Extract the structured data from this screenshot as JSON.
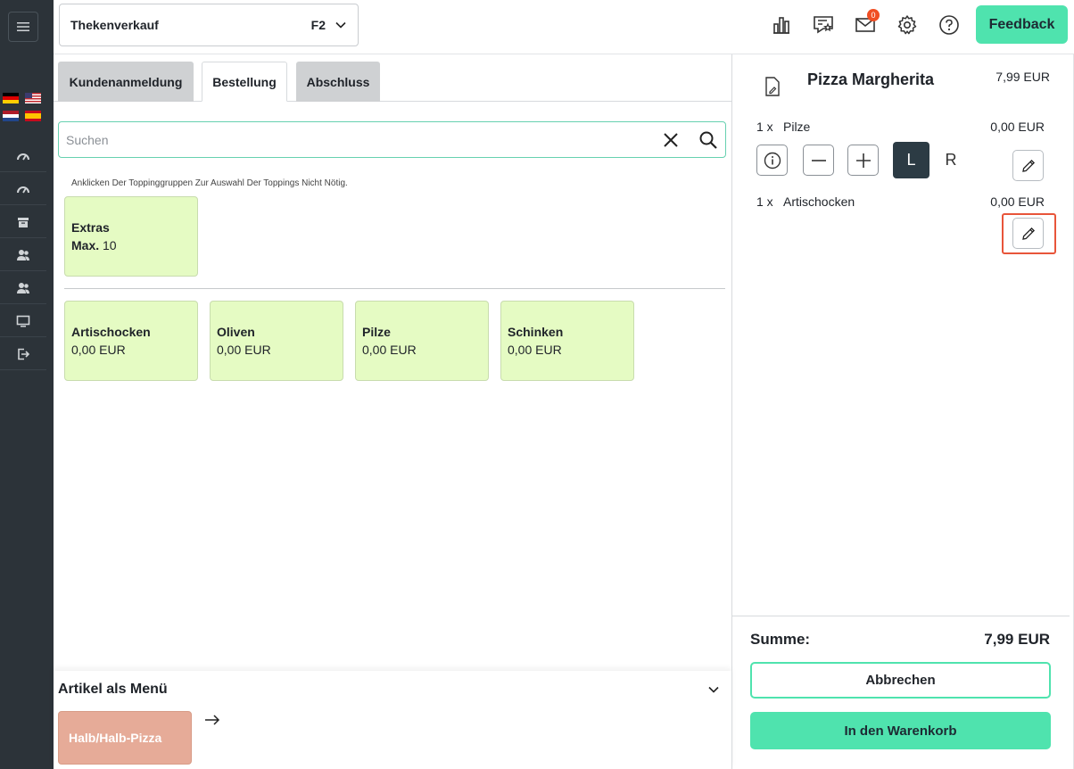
{
  "header": {
    "store_name": "Thekenverkauf",
    "store_key": "F2",
    "mail_count": "0",
    "feedback_label": "Feedback"
  },
  "tabs": [
    {
      "label": "Kundenanmeldung"
    },
    {
      "label": "Bestellung"
    },
    {
      "label": "Abschluss"
    }
  ],
  "search": {
    "placeholder": "Suchen",
    "value": ""
  },
  "hint": "Anklicken Der Toppinggruppen Zur Auswahl Der Toppings Nicht Nötig.",
  "group": {
    "title": "Extras",
    "max_label": "Max.",
    "max_value": "10"
  },
  "toppings": [
    {
      "name": "Artischocken",
      "price": "0,00 EUR"
    },
    {
      "name": "Oliven",
      "price": "0,00 EUR"
    },
    {
      "name": "Pilze",
      "price": "0,00 EUR"
    },
    {
      "name": "Schinken",
      "price": "0,00 EUR"
    }
  ],
  "menu_section": {
    "title": "Artikel als Menü",
    "item": "Halb/Halb-Pizza"
  },
  "cart": {
    "product": "Pizza Margherita",
    "product_price": "7,99 EUR",
    "items": [
      {
        "qty": "1 x",
        "name": "Pilze",
        "price": "0,00 EUR"
      },
      {
        "qty": "1 x",
        "name": "Artischocken",
        "price": "0,00 EUR"
      }
    ],
    "side_left": "L",
    "side_right": "R",
    "sum_label": "Summe:",
    "sum_value": "7,99 EUR",
    "cancel_label": "Abbrechen",
    "add_label": "In den Warenkorb"
  },
  "colors": {
    "accent": "#4fe3ae",
    "sidebar": "#2c3339",
    "card": "#e5fbc3",
    "highlight": "#e8553a"
  }
}
